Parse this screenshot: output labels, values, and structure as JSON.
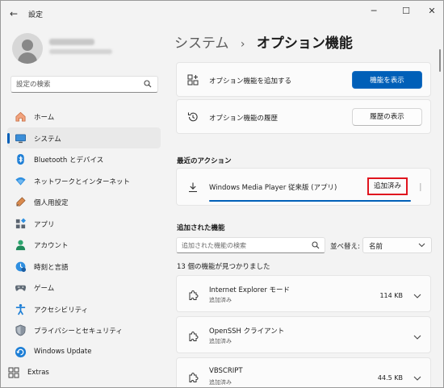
{
  "window": {
    "title": "設定",
    "back_glyph": "←",
    "minimize_glyph": "─",
    "maximize_glyph": "☐",
    "close_glyph": "✕"
  },
  "sidebar": {
    "search_placeholder": "設定の検索",
    "items": [
      {
        "label": "ホーム",
        "icon": "home-icon"
      },
      {
        "label": "システム",
        "icon": "system-icon",
        "selected": true
      },
      {
        "label": "Bluetooth とデバイス",
        "icon": "bluetooth-icon"
      },
      {
        "label": "ネットワークとインターネット",
        "icon": "network-icon"
      },
      {
        "label": "個人用設定",
        "icon": "personalization-icon"
      },
      {
        "label": "アプリ",
        "icon": "apps-icon"
      },
      {
        "label": "アカウント",
        "icon": "account-icon"
      },
      {
        "label": "時刻と言語",
        "icon": "time-language-icon"
      },
      {
        "label": "ゲーム",
        "icon": "gaming-icon"
      },
      {
        "label": "アクセシビリティ",
        "icon": "accessibility-icon"
      },
      {
        "label": "プライバシーとセキュリティ",
        "icon": "privacy-icon"
      },
      {
        "label": "Windows Update",
        "icon": "windows-update-icon"
      }
    ],
    "extras_label": "Extras"
  },
  "breadcrumb": {
    "parent": "システム",
    "separator": "›",
    "current": "オプション機能"
  },
  "add_feature": {
    "label": "オプション機能を追加する",
    "button": "機能を表示"
  },
  "history": {
    "label": "オプション機能の履歴",
    "button": "履歴の表示"
  },
  "recent_actions": {
    "title": "最近のアクション",
    "item_label": "Windows Media Player 従来版 (アプリ)",
    "status": "追加済み",
    "progress": 1.0
  },
  "added_features": {
    "title": "追加された機能",
    "search_placeholder": "追加された機能の検索",
    "sort_label": "並べ替え:",
    "sort_value": "名前",
    "count_text": "13 個の機能が見つかりました",
    "items": [
      {
        "name": "Internet Explorer モード",
        "status": "追加済み",
        "size": "114 KB"
      },
      {
        "name": "OpenSSH クライアント",
        "status": "追加済み",
        "size": ""
      },
      {
        "name": "VBSCRIPT",
        "status": "追加済み",
        "size": "44.5 KB"
      }
    ]
  },
  "colors": {
    "accent": "#005fb8",
    "highlight_box": "#e0141e"
  }
}
